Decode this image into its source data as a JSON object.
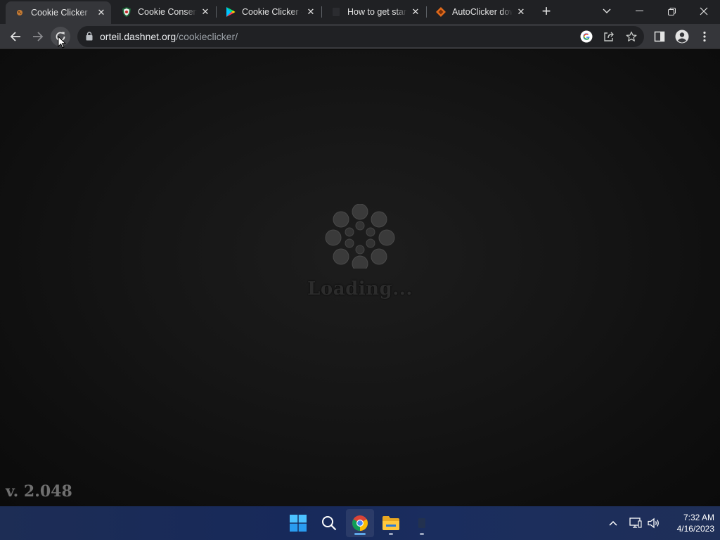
{
  "browser": {
    "tabs": [
      {
        "title": "Cookie Clicker",
        "icon": "cookie-icon",
        "active": true
      },
      {
        "title": "Cookie Consent",
        "icon": "consent-shield-icon",
        "active": false
      },
      {
        "title": "Cookie Clicker -",
        "icon": "google-play-icon",
        "active": false
      },
      {
        "title": "How to get star",
        "icon": "page-icon",
        "active": false
      },
      {
        "title": "AutoClicker dow",
        "icon": "diamond-icon",
        "active": false
      }
    ],
    "address": {
      "domain": "orteil.dashnet.org",
      "path": "/cookieclicker/"
    }
  },
  "page": {
    "loading_text": "Loading...",
    "version": "v. 2.048"
  },
  "taskbar": {
    "time": "7:32 AM",
    "date": "4/16/2023"
  },
  "colors": {
    "tabstrip": "#202124",
    "toolbar": "#35363a",
    "omnibox": "#202124",
    "page_background": "#0b0b0b",
    "taskbar": "#1a2b5a",
    "chrome_indicator": "#5ea6e8"
  }
}
